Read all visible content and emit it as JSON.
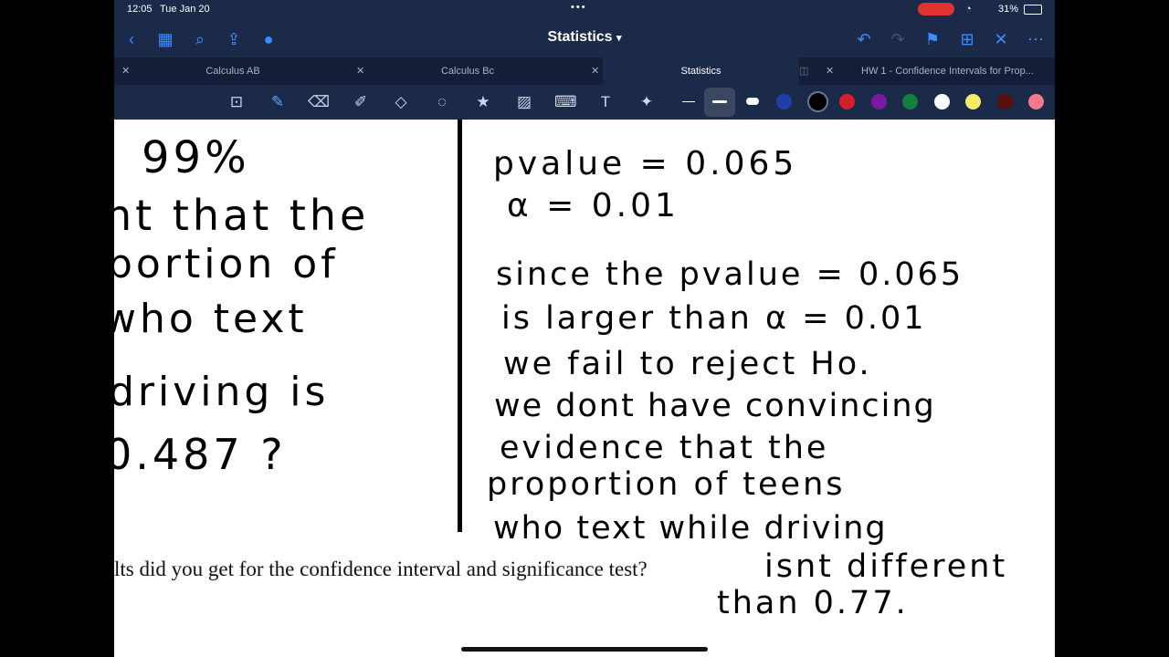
{
  "status_bar": {
    "time": "12:05",
    "date": "Tue Jan 20",
    "battery": "31%"
  },
  "header": {
    "title": "Statistics",
    "title_chevron_icon": "chevron-down-icon"
  },
  "tabs": [
    {
      "label": "Calculus AB",
      "active": false
    },
    {
      "label": "Calculus Bc",
      "active": false
    },
    {
      "label": "Statistics",
      "active": true
    },
    {
      "label": "HW 1 - Confidence Intervals for Prop...",
      "active": false
    }
  ],
  "toolbar": {
    "tools": [
      "lasso-zoom-icon",
      "pen-icon",
      "eraser-icon",
      "highlighter-icon",
      "shapes-icon",
      "lasso-icon",
      "sticker-icon",
      "image-icon",
      "keyboard-icon",
      "text-box-icon",
      "laser-pointer-icon"
    ],
    "colors": [
      "#1f3fa8",
      "#000000",
      "#d81e2b",
      "#7a1aa0",
      "#15803d",
      "#ffffff",
      "#f7ea6a",
      "#5a0f0f",
      "#f47c8a"
    ]
  },
  "note": {
    "left_lines": [
      "99%",
      "nt  that  the",
      "portion  of",
      "who   text",
      "driving   is",
      "  0.487 ?"
    ],
    "right_lines": [
      "pvalue = 0.065",
      "α = 0.01",
      "since  the  pvalue = 0.065",
      "is  larger  than  α = 0.01",
      "we  fail  to  reject  Ho.",
      "we  dont  have  convincing",
      "evidence  that  the",
      "proportion  of  teens",
      "who  text  while  driving",
      "isnt  different",
      "than  0.77."
    ],
    "question_text": "lts did you get for the confidence interval and significance test?"
  }
}
